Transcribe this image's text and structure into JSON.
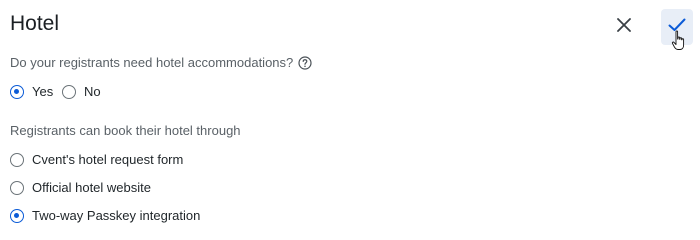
{
  "header": {
    "title": "Hotel"
  },
  "question": {
    "text": "Do your registrants need hotel accommodations?",
    "options": [
      {
        "label": "Yes",
        "checked": true
      },
      {
        "label": "No",
        "checked": false
      }
    ]
  },
  "booking": {
    "label": "Registrants can book their hotel through",
    "options": [
      {
        "label": "Cvent's hotel request form",
        "checked": false
      },
      {
        "label": "Official hotel website",
        "checked": false
      },
      {
        "label": "Two-way Passkey integration",
        "checked": true
      }
    ]
  },
  "icons": {
    "close": "close-icon",
    "confirm": "checkmark-icon",
    "help": "question-circle-icon",
    "cursor": "hand-pointer-icon"
  },
  "colors": {
    "accent": "#0b5bd7",
    "confirm_bg": "#e8eef7",
    "muted_text": "#5a6167"
  }
}
